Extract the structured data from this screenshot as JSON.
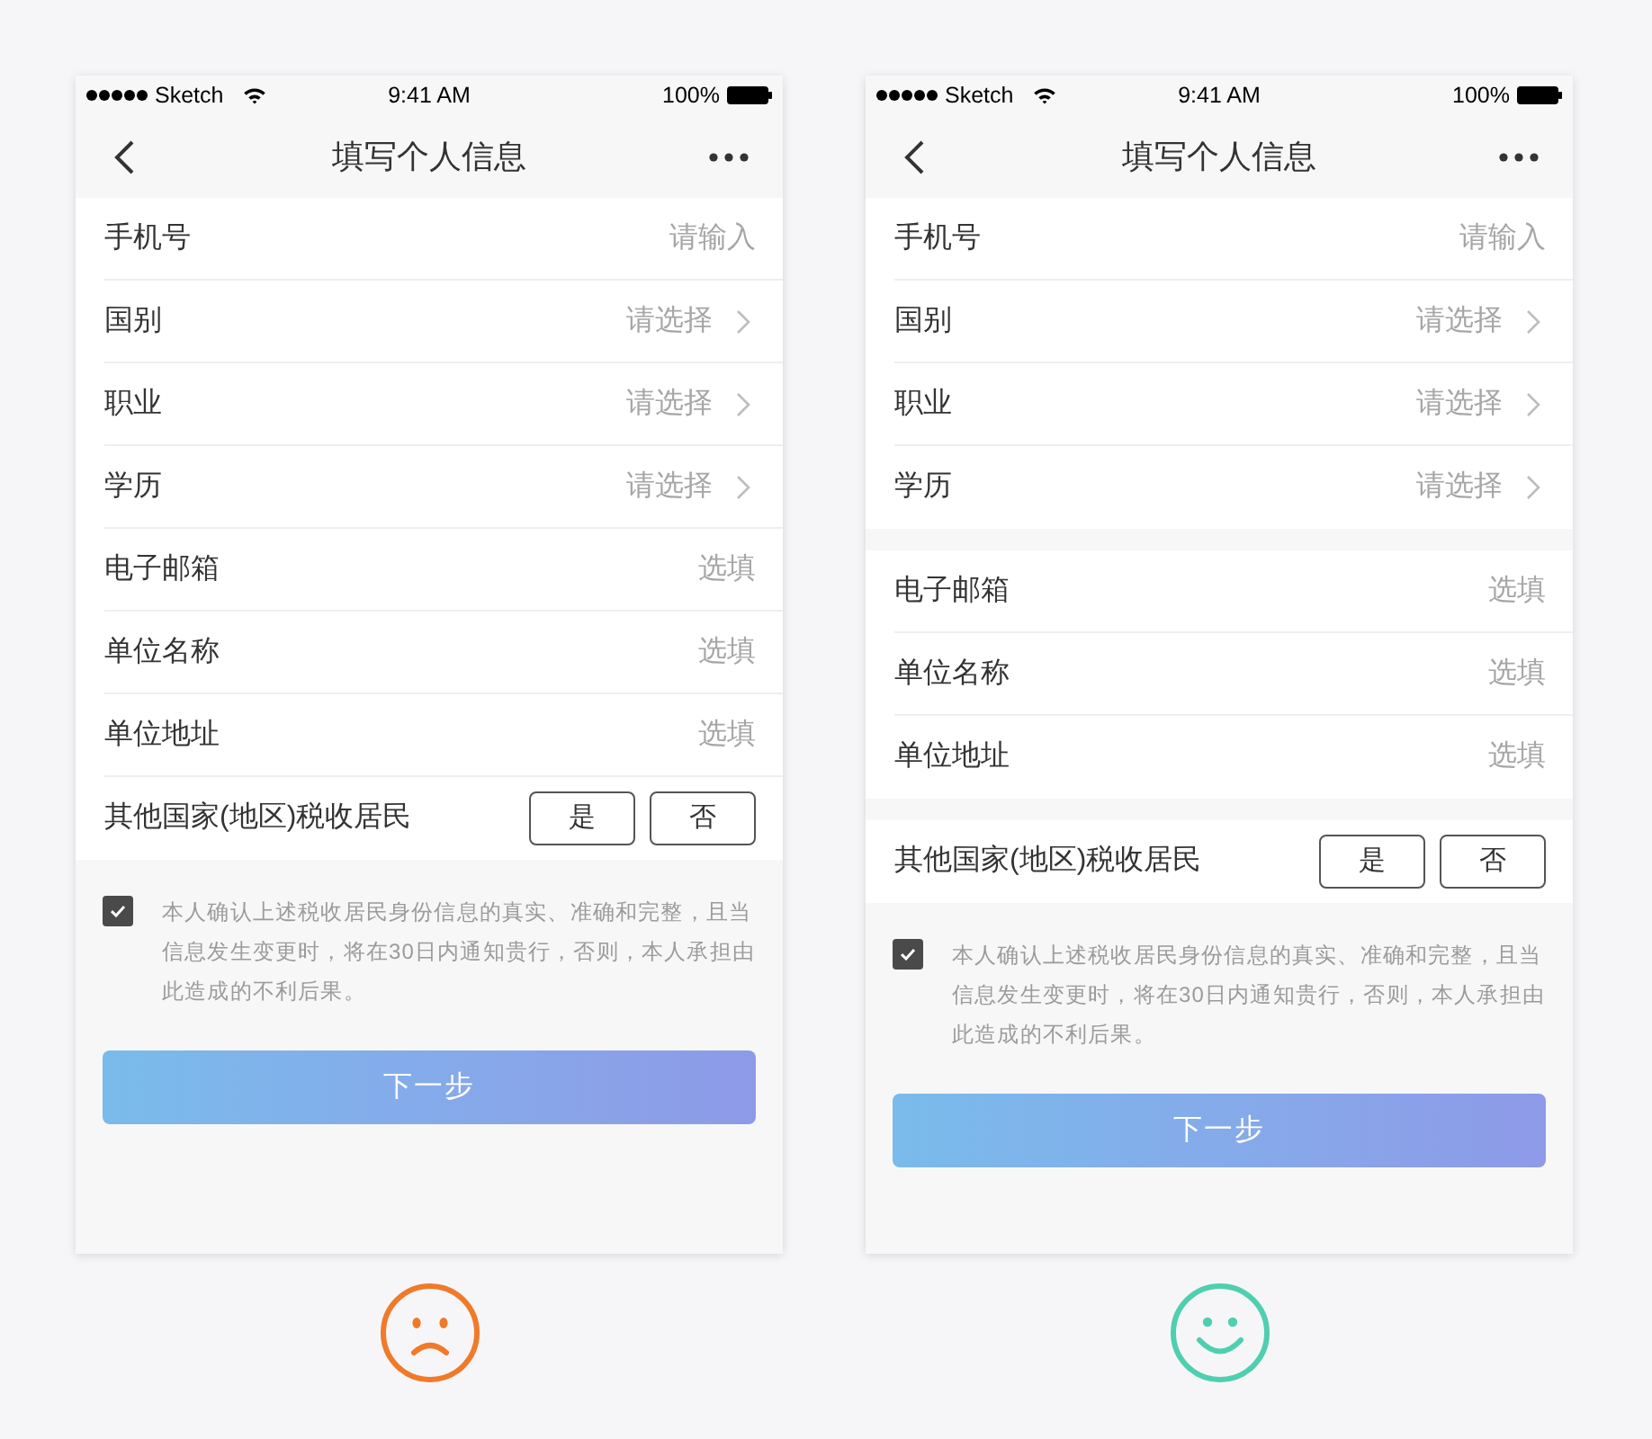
{
  "screens": [
    {
      "status_bar": {
        "carrier": "Sketch",
        "time": "9:41 AM",
        "battery": "100%"
      },
      "nav_bar": {
        "title": "填写个人信息"
      },
      "groups": [
        {
          "rows": [
            {
              "kind": "input",
              "label": "手机号",
              "placeholder": "请输入"
            },
            {
              "kind": "select",
              "label": "国别",
              "placeholder": "请选择"
            },
            {
              "kind": "select",
              "label": "职业",
              "placeholder": "请选择"
            },
            {
              "kind": "select",
              "label": "学历",
              "placeholder": "请选择"
            },
            {
              "kind": "input",
              "label": "电子邮箱",
              "placeholder": "选填"
            },
            {
              "kind": "input",
              "label": "单位名称",
              "placeholder": "选填"
            },
            {
              "kind": "input",
              "label": "单位地址",
              "placeholder": "选填"
            },
            {
              "kind": "choice",
              "label": "其他国家(地区)税收居民",
              "options": [
                {
                  "label": "是",
                  "selected": false
                },
                {
                  "label": "否",
                  "selected": false
                }
              ]
            }
          ]
        }
      ],
      "consent": {
        "checked": true,
        "text": "本人确认上述税收居民身份信息的真实、准确和完整，且当信息发生变更时，将在30日内通知贵行，否则，本人承担由此造成的不利后果。"
      },
      "next_button": {
        "label": "下一步",
        "disabled": true
      },
      "verdict": {
        "kind": "sad",
        "color": "#f07a2a"
      }
    },
    {
      "status_bar": {
        "carrier": "Sketch",
        "time": "9:41 AM",
        "battery": "100%"
      },
      "nav_bar": {
        "title": "填写个人信息"
      },
      "groups": [
        {
          "rows": [
            {
              "kind": "input",
              "label": "手机号",
              "placeholder": "请输入"
            },
            {
              "kind": "select",
              "label": "国别",
              "placeholder": "请选择"
            },
            {
              "kind": "select",
              "label": "职业",
              "placeholder": "请选择"
            },
            {
              "kind": "select",
              "label": "学历",
              "placeholder": "请选择"
            }
          ]
        },
        {
          "rows": [
            {
              "kind": "input",
              "label": "电子邮箱",
              "placeholder": "选填"
            },
            {
              "kind": "input",
              "label": "单位名称",
              "placeholder": "选填"
            },
            {
              "kind": "input",
              "label": "单位地址",
              "placeholder": "选填"
            }
          ]
        },
        {
          "rows": [
            {
              "kind": "choice",
              "label": "其他国家(地区)税收居民",
              "options": [
                {
                  "label": "是",
                  "selected": false
                },
                {
                  "label": "否",
                  "selected": false
                }
              ]
            }
          ]
        }
      ],
      "consent": {
        "checked": true,
        "text": "本人确认上述税收居民身份信息的真实、准确和完整，且当信息发生变更时，将在30日内通知贵行，否则，本人承担由此造成的不利后果。"
      },
      "next_button": {
        "label": "下一步",
        "disabled": true
      },
      "verdict": {
        "kind": "happy",
        "color": "#4fcfb0"
      }
    }
  ]
}
